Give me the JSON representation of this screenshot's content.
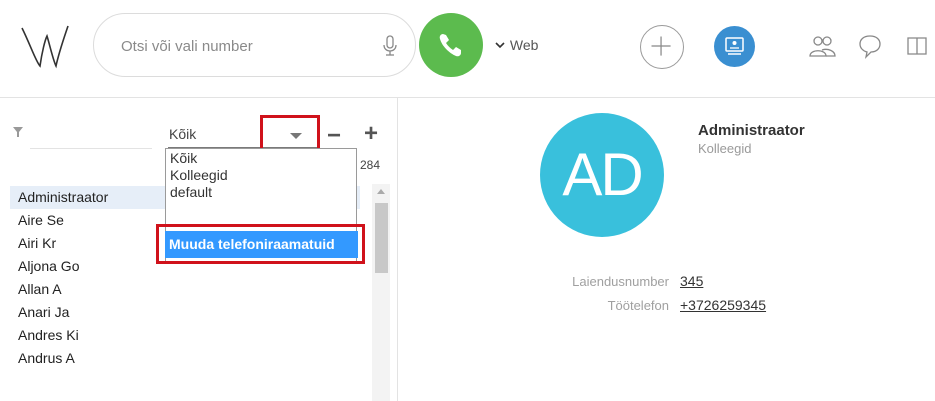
{
  "header": {
    "search_placeholder": "Otsi või vali number",
    "line_label": "Web"
  },
  "phonebook": {
    "selected": "Kõik",
    "options": [
      "Kõik",
      "Kolleegid",
      "default"
    ],
    "edit_label": "Muuda telefoniraamatuid",
    "count": "284"
  },
  "contacts": [
    "Administraator",
    "Aire Se",
    "Airi Kr",
    "Aljona Go",
    "Allan A",
    "Anari Ja",
    "Andres Ki",
    "Andrus A"
  ],
  "detail": {
    "initials": "AD",
    "name": "Administraator",
    "group": "Kolleegid",
    "ext_label": "Laiendusnumber",
    "ext_value": "345",
    "work_label": "Töötelefon",
    "work_value": "+3726259345"
  },
  "colors": {
    "call_green": "#5cbb4e",
    "avatar_cyan": "#39c0dc",
    "highlight_red": "#d0121b",
    "selection_blue": "#3399ff",
    "screen_blue": "#3a8fd1"
  }
}
